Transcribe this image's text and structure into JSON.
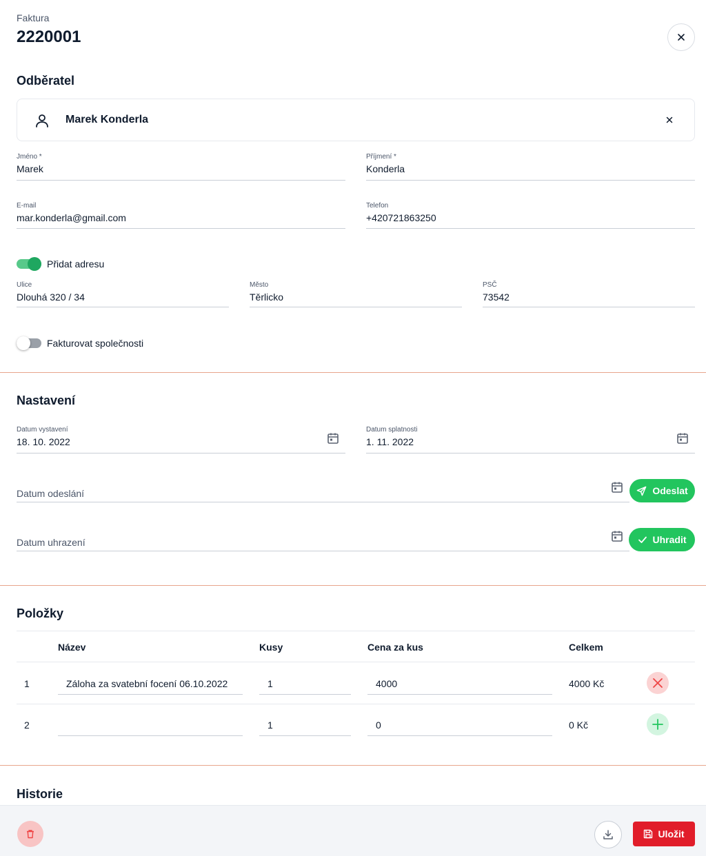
{
  "header": {
    "label": "Faktura",
    "number": "2220001"
  },
  "customer": {
    "section_title": "Odběratel",
    "card_name": "Marek Konderla",
    "first_name": {
      "label": "Jméno *",
      "value": "Marek"
    },
    "last_name": {
      "label": "Příjmení *",
      "value": "Konderla"
    },
    "email": {
      "label": "E-mail",
      "value": "mar.konderla@gmail.com"
    },
    "phone": {
      "label": "Telefon",
      "value": "+420721863250"
    },
    "add_address": {
      "label": "Přidat adresu",
      "on": true
    },
    "street": {
      "label": "Ulice",
      "value": "Dlouhá 320 / 34"
    },
    "city": {
      "label": "Město",
      "value": "Těrlicko"
    },
    "zip": {
      "label": "PSČ",
      "value": "73542"
    },
    "bill_company": {
      "label": "Fakturovat společnosti",
      "on": false
    }
  },
  "settings": {
    "section_title": "Nastavení",
    "issue_date": {
      "label": "Datum vystavení",
      "value": "18. 10. 2022"
    },
    "due_date": {
      "label": "Datum splatnosti",
      "value": "1. 11. 2022"
    },
    "sent_date": {
      "placeholder": "Datum odeslání"
    },
    "paid_date": {
      "placeholder": "Datum uhrazení"
    },
    "send_button": "Odeslat",
    "pay_button": "Uhradit"
  },
  "items": {
    "section_title": "Položky",
    "columns": [
      "Název",
      "Kusy",
      "Cena za kus",
      "Celkem"
    ],
    "rows": [
      {
        "index": "1",
        "name": "Záloha za svatební focení 06.10.2022",
        "qty": "1",
        "price": "4000",
        "total": "4000 Kč",
        "action": "remove"
      },
      {
        "index": "2",
        "name": "",
        "qty": "1",
        "price": "0",
        "total": "0 Kč",
        "action": "add"
      }
    ]
  },
  "history": {
    "section_title": "Historie"
  },
  "footer": {
    "save_label": "Uložit"
  },
  "colors": {
    "accent_green": "#22c55e",
    "danger_red": "#e11d2a",
    "divider": "#e8a58c",
    "navy": "#0f1b2d"
  }
}
